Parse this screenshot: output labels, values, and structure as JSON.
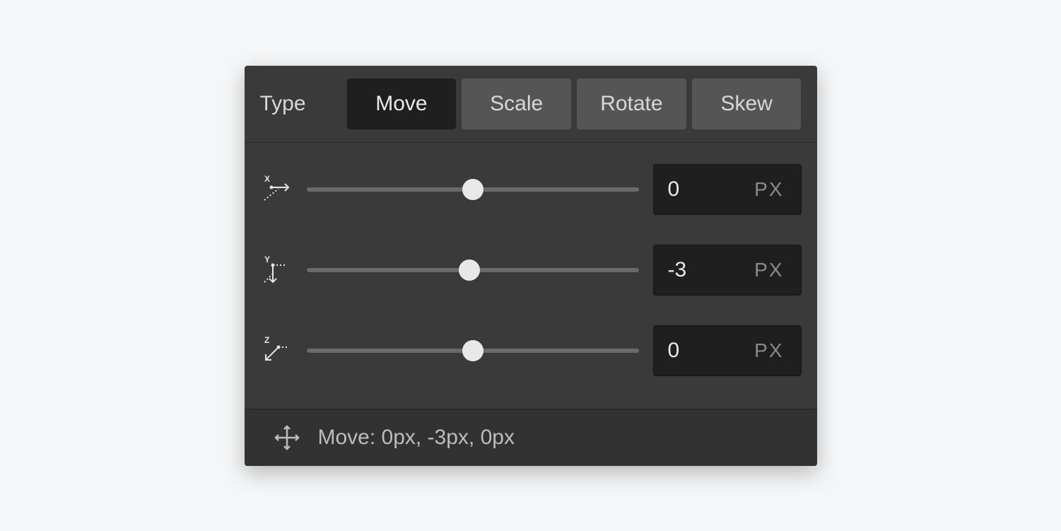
{
  "header": {
    "type_label": "Type",
    "tabs": [
      {
        "label": "Move",
        "active": true
      },
      {
        "label": "Scale",
        "active": false
      },
      {
        "label": "Rotate",
        "active": false
      },
      {
        "label": "Skew",
        "active": false
      }
    ]
  },
  "sliders": {
    "x": {
      "value": "0",
      "unit": "PX",
      "thumb_percent": 50
    },
    "y": {
      "value": "-3",
      "unit": "PX",
      "thumb_percent": 49
    },
    "z": {
      "value": "0",
      "unit": "PX",
      "thumb_percent": 50
    }
  },
  "summary": {
    "text": "Move: 0px, -3px, 0px"
  }
}
